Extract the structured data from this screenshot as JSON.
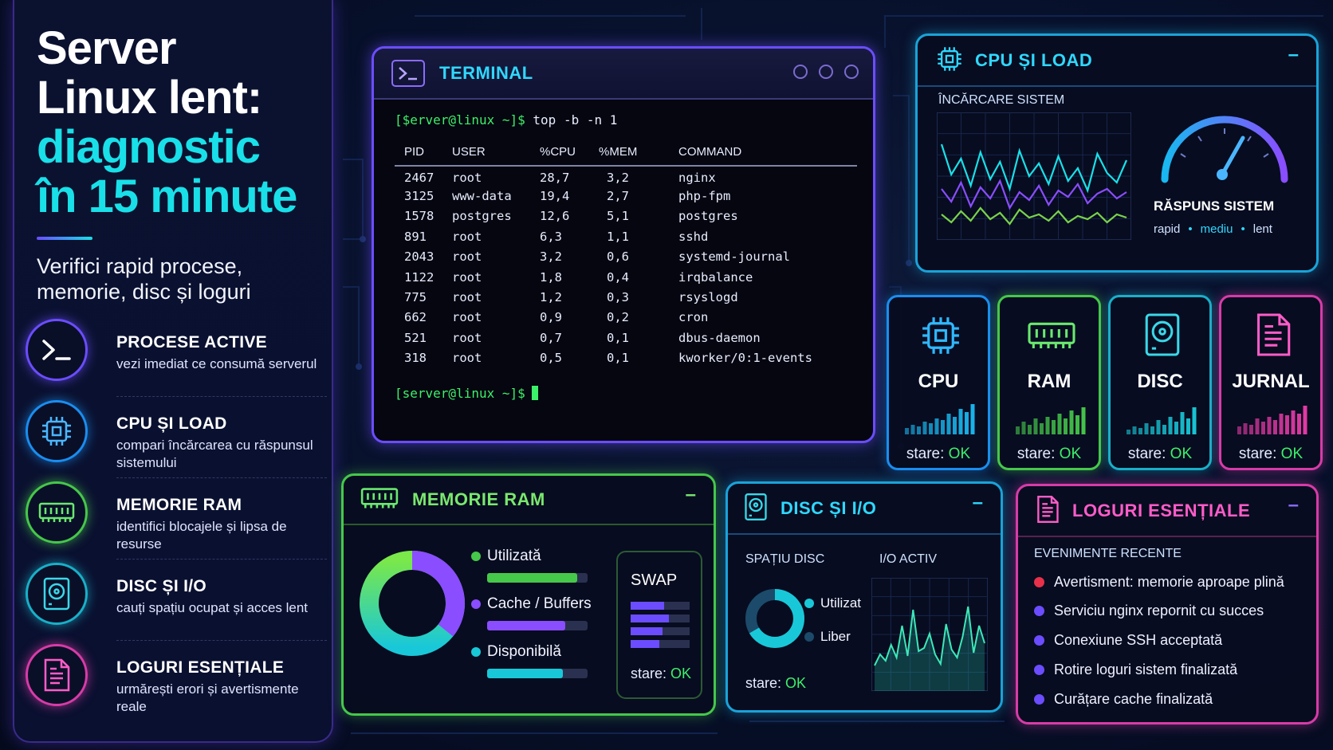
{
  "colors": {
    "accent_cyan": "#19e0e8",
    "accent_purple": "#6b4dff",
    "accent_green": "#3df06a",
    "accent_blue": "#1aa3d8",
    "accent_pink": "#d83ba8"
  },
  "headline": {
    "line1": "Server",
    "line2": "Linux lent:",
    "line3": "diagnostic",
    "line4": "în 15 minute",
    "subtitle": "Verifici rapid procese, memorie, disc și loguri"
  },
  "features": [
    {
      "icon": "terminal-icon",
      "title": "PROCESE ACTIVE",
      "desc": "vezi imediat ce consumă serverul"
    },
    {
      "icon": "cpu-chip-icon",
      "title": "CPU ȘI LOAD",
      "desc": "compari încărcarea cu răspunsul sistemului"
    },
    {
      "icon": "ram-module-icon",
      "title": "MEMORIE RAM",
      "desc": "identifici blocajele și lipsa de resurse"
    },
    {
      "icon": "hard-disk-icon",
      "title": "DISC ȘI I/O",
      "desc": "cauți spațiu ocupat și acces lent"
    },
    {
      "icon": "log-file-icon",
      "title": "LOGURI ESENȚIALE",
      "desc": "urmărești erori și avertismente reale"
    }
  ],
  "terminal": {
    "title": "TERMINAL",
    "prompt1": "[$erver@linux ~]$",
    "command": "top -b -n 1",
    "columns": [
      "PID",
      "USER",
      "%CPU",
      "%MEM",
      "COMMAND"
    ],
    "rows": [
      [
        "2467",
        "root",
        "28,7",
        "3,2",
        "nginx"
      ],
      [
        "3125",
        "www-data",
        "19,4",
        "2,7",
        "php-fpm"
      ],
      [
        "1578",
        "postgres",
        "12,6",
        "5,1",
        "postgres"
      ],
      [
        "891",
        "root",
        "6,3",
        "1,1",
        "sshd"
      ],
      [
        "2043",
        "root",
        "3,2",
        "0,6",
        "systemd-journal"
      ],
      [
        "1122",
        "root",
        "1,8",
        "0,4",
        "irqbalance"
      ],
      [
        "775",
        "root",
        "1,2",
        "0,3",
        "rsyslogd"
      ],
      [
        "662",
        "root",
        "0,9",
        "0,2",
        "cron"
      ],
      [
        "521",
        "root",
        "0,7",
        "0,1",
        "dbus-daemon"
      ],
      [
        "318",
        "root",
        "0,5",
        "0,1",
        "kworker/0:1-events"
      ]
    ],
    "prompt2": "[server@linux ~]$"
  },
  "cpuload": {
    "title": "CPU ȘI LOAD",
    "minimize": "–",
    "section": "ÎNCĂRCARE SISTEM",
    "response_title": "RĂSPUNS SISTEM",
    "speed_labels": [
      "rapid",
      "mediu",
      "lent"
    ],
    "series_colors": [
      "#19e0e8",
      "#8a4dff",
      "#7ad34a"
    ]
  },
  "cards": [
    {
      "name": "CPU",
      "state_label": "stare:",
      "state": "OK",
      "icon": "cpu-chip-icon",
      "color": "#19b8f0"
    },
    {
      "name": "RAM",
      "state_label": "stare:",
      "state": "OK",
      "icon": "ram-module-icon",
      "color": "#46c84a"
    },
    {
      "name": "DISC",
      "state_label": "stare:",
      "state": "OK",
      "icon": "hard-disk-icon",
      "color": "#19c8d8"
    },
    {
      "name": "JURNAL",
      "state_label": "stare:",
      "state": "OK",
      "icon": "log-file-icon",
      "color": "#e83ba8"
    }
  ],
  "memram": {
    "title": "MEMORIE RAM",
    "minimize": "–",
    "legend": [
      {
        "label": "Utilizată",
        "color": "#46c84a",
        "fill": 0.9
      },
      {
        "label": "Cache / Buffers",
        "color": "#8a4dff",
        "fill": 0.78
      },
      {
        "label": "Disponibilă",
        "color": "#19c8d8",
        "fill": 0.75
      }
    ],
    "swap_title": "SWAP",
    "swap_state_label": "stare:",
    "swap_state": "OK"
  },
  "disc": {
    "title": "DISC ȘI I/O",
    "minimize": "–",
    "space_label": "SPAȚIU DISC",
    "io_label": "I/O ACTIV",
    "legend_used": "Utilizat",
    "legend_free": "Liber",
    "state_label": "stare:",
    "state": "OK"
  },
  "logs": {
    "title": "LOGURI ESENȚIALE",
    "minimize": "–",
    "section": "EVENIMENTE RECENTE",
    "events": [
      {
        "text": "Avertisment: memorie aproape plină",
        "color": "#e8304a"
      },
      {
        "text": "Serviciu nginx repornit cu succes",
        "color": "#6b4dff"
      },
      {
        "text": "Conexiune SSH acceptată",
        "color": "#6b4dff"
      },
      {
        "text": "Rotire loguri sistem finalizată",
        "color": "#6b4dff"
      },
      {
        "text": "Curățare cache finalizată",
        "color": "#6b4dff"
      }
    ]
  }
}
